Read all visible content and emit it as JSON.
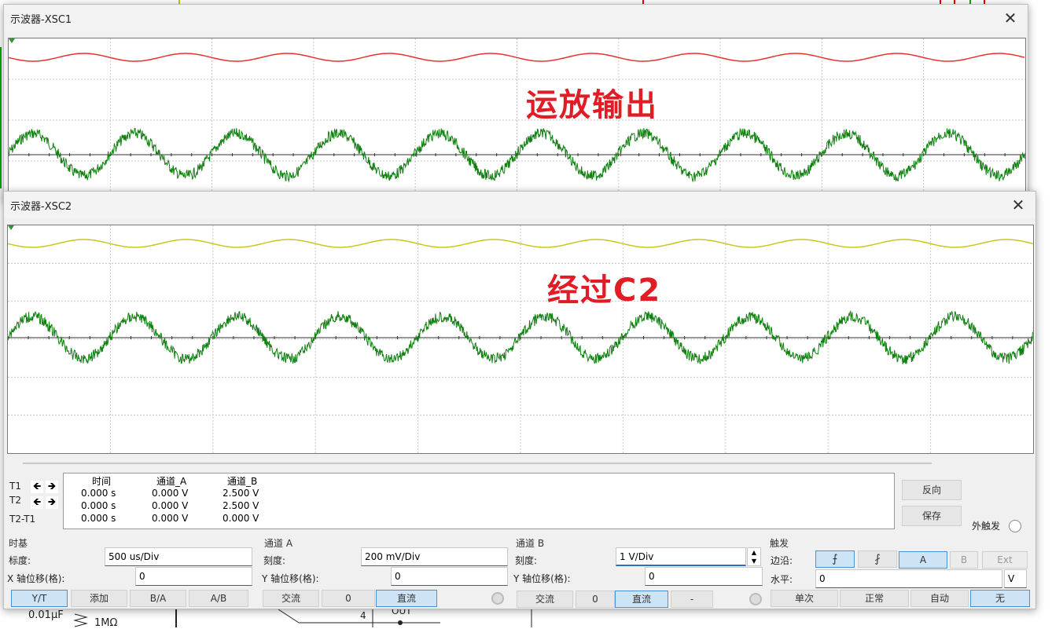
{
  "windows": {
    "xsc1": {
      "title": "示波器-XSC1",
      "overlay_label": "运放输出",
      "trace_colors": {
        "channel_a": "#e8312f",
        "channel_b": "#108010"
      }
    },
    "xsc2": {
      "title": "示波器-XSC2",
      "overlay_label": "经过C2",
      "trace_colors": {
        "channel_a": "#c8c81a",
        "channel_b": "#108010"
      }
    }
  },
  "readout": {
    "headers": {
      "time": "时间",
      "channel_a": "通道_A",
      "channel_b": "通道_B"
    },
    "rows": [
      {
        "label": "T1",
        "time": "0.000 s",
        "a": "0.000 V",
        "b": "2.500 V"
      },
      {
        "label": "T2",
        "time": "0.000 s",
        "a": "0.000 V",
        "b": "2.500 V"
      },
      {
        "label": "T2-T1",
        "time": "0.000 s",
        "a": "0.000 V",
        "b": "0.000 V"
      }
    ],
    "reverse_button": "反向",
    "save_button": "保存",
    "ext_trigger_label": "外触发"
  },
  "timebase": {
    "title": "时基",
    "scale_label": "标度:",
    "scale_value": "500 us/Div",
    "x_offset_label": "X 轴位移(格):",
    "x_offset_value": "0",
    "buttons": [
      "Y/T",
      "添加",
      "B/A",
      "A/B"
    ]
  },
  "channel_a": {
    "title": "通道 A",
    "scale_label": "刻度:",
    "scale_value": "200 mV/Div",
    "y_offset_label": "Y 轴位移(格):",
    "y_offset_value": "0",
    "buttons": [
      "交流",
      "0",
      "直流"
    ]
  },
  "channel_b": {
    "title": "通道 B",
    "scale_label": "刻度:",
    "scale_value": "1  V/Div",
    "y_offset_label": "Y 轴位移(格):",
    "y_offset_value": "0",
    "buttons": [
      "交流",
      "0",
      "直流",
      "-"
    ]
  },
  "trigger": {
    "title": "触发",
    "edge_label": "边沿:",
    "level_label": "水平:",
    "level_value": "0",
    "level_unit": "V",
    "source_buttons": [
      "A",
      "B",
      "Ext"
    ],
    "mode_buttons": [
      "单次",
      "正常",
      "自动",
      "无"
    ]
  },
  "schematic": {
    "cap_label": "0.01μF",
    "res_label": "1MΩ",
    "pin_label": "4",
    "net_label": "OUT"
  }
}
